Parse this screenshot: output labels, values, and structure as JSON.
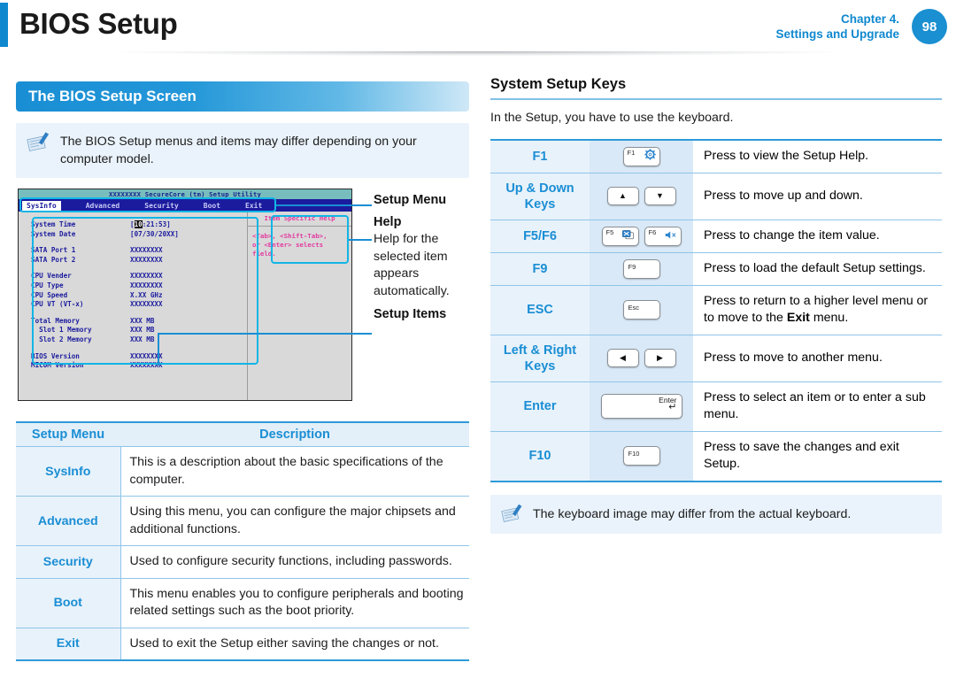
{
  "header": {
    "title": "BIOS Setup",
    "chapter_line1": "Chapter 4.",
    "chapter_line2": "Settings and Upgrade",
    "page_number": "98",
    "accent_color": "#0f88cf"
  },
  "left": {
    "section_title": "The BIOS Setup Screen",
    "note": "The BIOS Setup menus and items may differ depending on your computer model.",
    "note_icon": "notepad-pencil-icon"
  },
  "bios_screen": {
    "title_bar": "XXXXXXXX SecureCore (tm) Setup Utility",
    "menu_tabs": [
      "SysInfo",
      "Advanced",
      "Security",
      "Boot",
      "Exit"
    ],
    "active_tab": "SysInfo",
    "items": [
      {
        "label": "System Time",
        "value_prefix": "[",
        "value_highlight": "10",
        "value_suffix": ":21:53]"
      },
      {
        "label": "System Date",
        "value": "[07/30/20XX]"
      },
      {
        "gap": true
      },
      {
        "label": "SATA Port 1",
        "value": "XXXXXXXX"
      },
      {
        "label": "SATA Port 2",
        "value": "XXXXXXXX"
      },
      {
        "gap": true
      },
      {
        "label": "CPU Vender",
        "value": "XXXXXXXX"
      },
      {
        "label": "CPU Type",
        "value": "XXXXXXXX"
      },
      {
        "label": "CPU Speed",
        "value": "X.XX GHz"
      },
      {
        "label": "CPU VT (VT-x)",
        "value": "XXXXXXXX"
      },
      {
        "gap": true
      },
      {
        "label": "Total Memory",
        "value": "XXX MB"
      },
      {
        "label": "  Slot 1 Memory",
        "value": "XXX MB"
      },
      {
        "label": "  Slot 2 Memory",
        "value": "XXX MB"
      },
      {
        "gap": true
      },
      {
        "label": "BIOS Version",
        "value": "XXXXXXXX"
      },
      {
        "label": "MICOM Version",
        "value": "XXXXXXXX"
      }
    ],
    "help_panel": {
      "heading": "Item Specific Help",
      "text": "<Tab>, <Shift-Tab>,\nor <Enter> selects\nfield."
    },
    "callouts": {
      "setup_menu": "Setup Menu",
      "help": "Help",
      "help_body": "Help for the selected item appears automatically.",
      "setup_items": "Setup Items"
    }
  },
  "menu_table": {
    "headers": [
      "Setup Menu",
      "Description"
    ],
    "rows": [
      {
        "menu": "SysInfo",
        "description": "This is a description about the basic specifications of the computer."
      },
      {
        "menu": "Advanced",
        "description": "Using this menu, you can configure the major chipsets and additional functions."
      },
      {
        "menu": "Security",
        "description": "Used to configure security functions, including passwords."
      },
      {
        "menu": "Boot",
        "description": "This menu enables you to configure peripherals and booting related settings such as the boot priority."
      },
      {
        "menu": "Exit",
        "description": "Used to exit the Setup either saving the changes or not."
      }
    ]
  },
  "right": {
    "section_title": "System Setup Keys",
    "intro": "In the Setup, you have to use the keyboard.",
    "keys": [
      {
        "name": "F1",
        "cap_label": "F1",
        "cap_icon": "gear-icon",
        "cap_style": "single",
        "description": "Press to view the Setup Help."
      },
      {
        "name": "Up & Down Keys",
        "cap_label": "",
        "cap_icon": "arrow-up-icon,arrow-down-icon",
        "cap_style": "arrows-vertical",
        "description": "Press to move up and down."
      },
      {
        "name": "F5/F6",
        "cap_label": "F5,F6",
        "cap_icon": "touchpad-off-icon,speaker-mute-icon",
        "cap_style": "double",
        "description": "Press to change the item value."
      },
      {
        "name": "F9",
        "cap_label": "F9",
        "cap_icon": "",
        "cap_style": "single",
        "description": "Press to load the default Setup settings."
      },
      {
        "name": "ESC",
        "cap_label": "Esc",
        "cap_icon": "",
        "cap_style": "single",
        "description_pre": "Press to return to a higher level menu or to move to the ",
        "description_bold": "Exit",
        "description_post": " menu."
      },
      {
        "name": "Left & Right Keys",
        "cap_label": "",
        "cap_icon": "arrow-left-icon,arrow-right-icon",
        "cap_style": "arrows-horizontal",
        "description": "Press to move to another menu."
      },
      {
        "name": "Enter",
        "cap_label": "Enter",
        "cap_icon": "enter-arrow-icon",
        "cap_style": "wide",
        "description": "Press to select an item or to enter a sub menu."
      },
      {
        "name": "F10",
        "cap_label": "F10",
        "cap_icon": "",
        "cap_style": "single",
        "description": "Press to save the changes and exit Setup."
      }
    ],
    "note": "The keyboard image may differ from the actual keyboard.",
    "note_icon": "notepad-pencil-icon"
  }
}
